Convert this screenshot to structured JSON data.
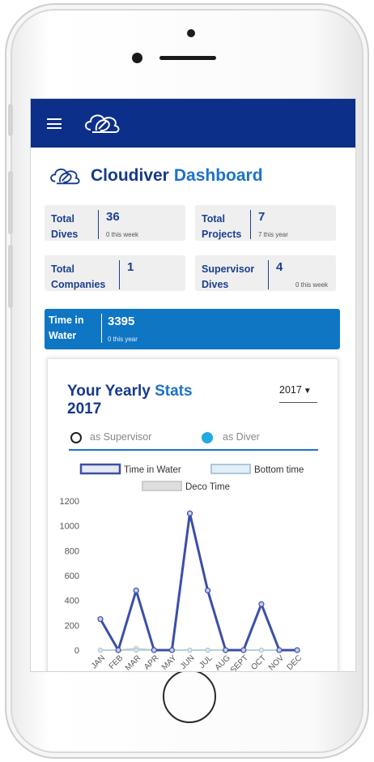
{
  "app": {
    "name_part1": "Cloudiver",
    "name_part2": "Dashboard"
  },
  "stats": [
    {
      "label_line1": "Total",
      "label_line2": "Dives",
      "value": "36",
      "sub": "0 this week"
    },
    {
      "label_line1": "Total",
      "label_line2": "Projects",
      "value": "7",
      "sub": "7 this year"
    },
    {
      "label_line1": "Total",
      "label_line2": "Companies",
      "value": "1",
      "sub": ""
    },
    {
      "label_line1": "Supervisor",
      "label_line2": "Dives",
      "value": "4",
      "sub": "0 this week"
    }
  ],
  "time_in_water": {
    "label_line1": "Time in",
    "label_line2": "Water",
    "value": "3395",
    "sub": "0 this year"
  },
  "yearly": {
    "title_part1": "Your Yearly",
    "title_part2": "Stats",
    "title_year": "2017",
    "year_selected": "2017",
    "toggle_supervisor": "as Supervisor",
    "toggle_diver": "as Diver"
  },
  "chart_data": {
    "type": "line",
    "categories": [
      "JAN",
      "FEB",
      "MAR",
      "APR",
      "MAY",
      "JUN",
      "JUL",
      "AUG",
      "SEPT",
      "OCT",
      "NOV",
      "DEC"
    ],
    "series": [
      {
        "name": "Time in Water",
        "color": "#3b4fa8",
        "values": [
          250,
          0,
          480,
          0,
          0,
          1100,
          480,
          0,
          0,
          370,
          0,
          0
        ]
      },
      {
        "name": "Bottom time",
        "color": "#a9c8dc",
        "values": [
          0,
          0,
          0,
          0,
          0,
          0,
          0,
          0,
          0,
          0,
          0,
          0
        ]
      },
      {
        "name": "Deco Time",
        "color": "#cccccc",
        "values": [
          0,
          0,
          15,
          0,
          0,
          0,
          0,
          0,
          0,
          0,
          0,
          0
        ]
      }
    ],
    "ylim": [
      0,
      1200
    ],
    "yticks": [
      0,
      200,
      400,
      600,
      800,
      1000,
      1200
    ],
    "legend_position": "top"
  }
}
